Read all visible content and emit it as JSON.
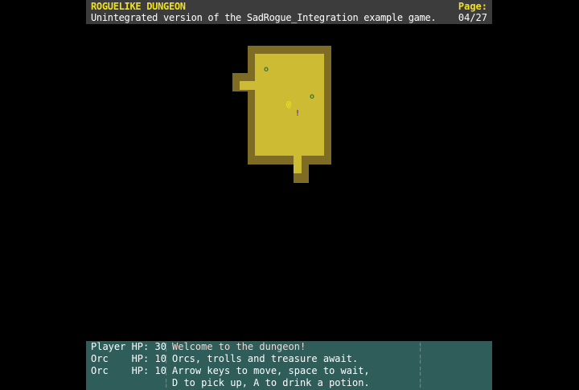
{
  "header": {
    "title": "ROGUELIKE DUNGEON",
    "subtitle": "Unintegrated version of the SadRogue_Integration example game.",
    "page_label": "Page:",
    "page_number": "04/27"
  },
  "entities": {
    "player_glyph": "@",
    "enemy_glyph": "o",
    "item_glyph": "!"
  },
  "colors": {
    "wall": "#7e6b24",
    "floor": "#cdbb34",
    "player": "#f0e020",
    "enemy": "#3f7a2f",
    "potion": "#6a2fc0",
    "status_bg": "#2f5d5a",
    "header_bg": "#3c3c3c"
  },
  "status": {
    "stats": [
      "Player HP: 30",
      "Orc    HP: 10",
      "Orc    HP: 10"
    ],
    "messages": [
      "Welcome to the dungeon!",
      "Orcs, trolls and treasure await.",
      "Arrow keys to move, space to wait,",
      "D to pick up, A to drink a potion."
    ]
  }
}
